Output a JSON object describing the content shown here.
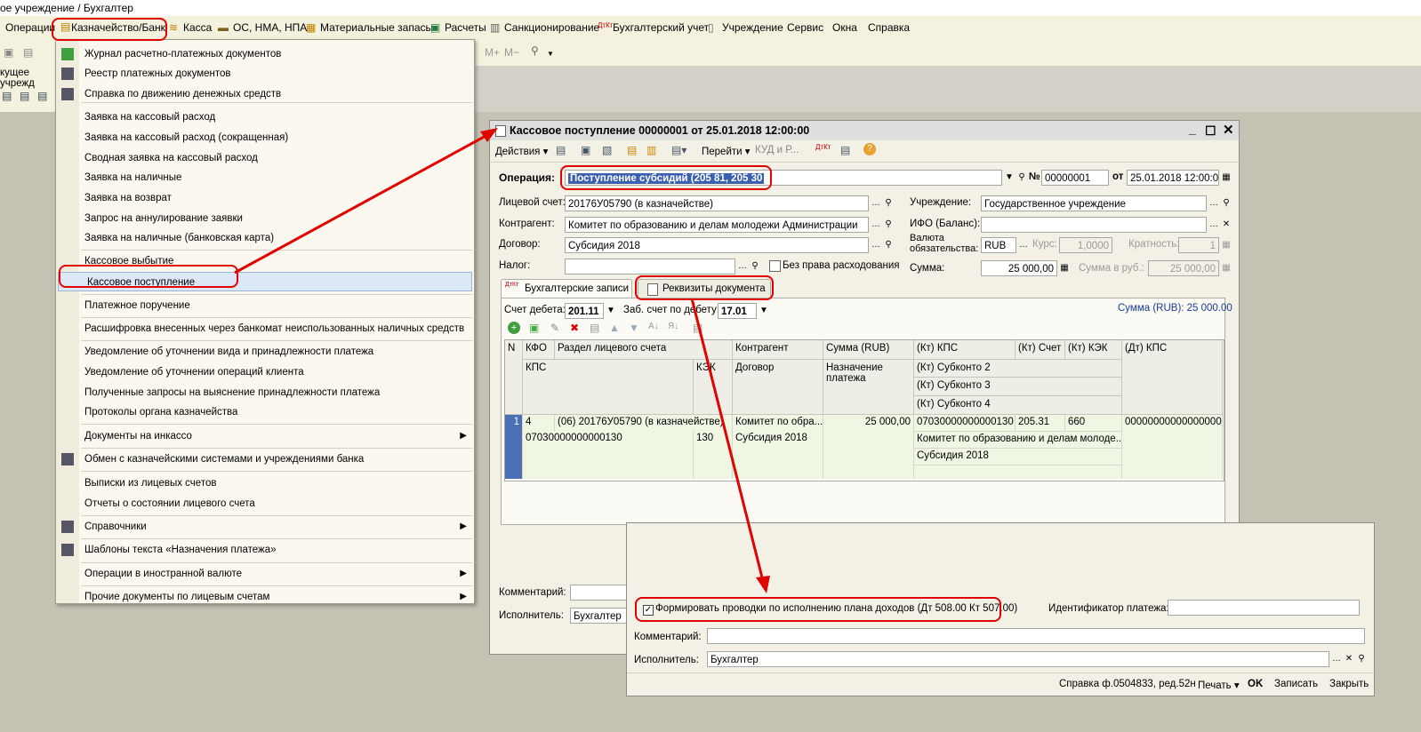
{
  "app_title": "ое учреждение / Бухгалтер",
  "menubar": {
    "items": [
      "Операции",
      "Казначейство/Банк",
      "Касса",
      "ОС, НМА, НПА",
      "Материальные запасы",
      "Расчеты",
      "Санкционирование",
      "Бухгалтерский учет",
      "Учреждение",
      "Сервис",
      "Окна",
      "Справка"
    ]
  },
  "sidebar_label": "кущее учрежд",
  "toolbar_right": {
    "mplus": "М+",
    "mminus": "М−"
  },
  "menu": {
    "items": [
      {
        "label": "Журнал  расчетно-платежных документов",
        "arrow": false
      },
      {
        "label": "Реестр платежных документов",
        "arrow": false
      },
      {
        "label": "Справка по движению денежных средств",
        "arrow": false
      },
      {
        "label": "Заявка на кассовый расход",
        "arrow": false
      },
      {
        "label": "Заявка на кассовый расход (сокращенная)",
        "arrow": false
      },
      {
        "label": "Сводная заявка на кассовый расход",
        "arrow": false
      },
      {
        "label": "Заявка на наличные",
        "arrow": false
      },
      {
        "label": "Заявка на возврат",
        "arrow": false
      },
      {
        "label": "Запрос на аннулирование заявки",
        "arrow": false
      },
      {
        "label": "Заявка на наличные (банковская карта)",
        "arrow": false
      },
      {
        "label": "Кассовое выбытие",
        "arrow": false
      },
      {
        "label": "Кассовое поступление",
        "arrow": false
      },
      {
        "label": "Платежное поручение",
        "arrow": false
      },
      {
        "label": "Расшифровка внесенных через банкомат неиспользованных наличных средств",
        "arrow": false
      },
      {
        "label": "Уведомление об уточнении вида и принадлежности платежа",
        "arrow": false
      },
      {
        "label": "Уведомление об уточнении операций клиента",
        "arrow": false
      },
      {
        "label": "Полученные запросы на выяснение принадлежности платежа",
        "arrow": false
      },
      {
        "label": "Протоколы органа казначейства",
        "arrow": false
      },
      {
        "label": "Документы на инкассо",
        "arrow": true
      },
      {
        "label": "Обмен с казначейскими системами и учреждениями банка",
        "arrow": false
      },
      {
        "label": "Выписки из лицевых счетов",
        "arrow": false
      },
      {
        "label": "Отчеты о состоянии лицевого счета",
        "arrow": false
      },
      {
        "label": "Справочники",
        "arrow": true
      },
      {
        "label": "Шаблоны текста «Назначения платежа»",
        "arrow": false
      },
      {
        "label": "Операции в иностранной валюте",
        "arrow": true
      },
      {
        "label": "Прочие документы по лицевым счетам",
        "arrow": true
      }
    ]
  },
  "doc": {
    "title": "Кассовое поступление 00000001 от 25.01.2018 12:00:00",
    "toolbar": {
      "actions": "Действия",
      "goto": "Перейти",
      "kud": "КУД и Р..."
    },
    "operation_label": "Операция:",
    "operation_value": "Поступление субсидий (205 81, 205 30",
    "number_label": "№",
    "number_value": "00000001",
    "date_label": "от",
    "date_value": "25.01.2018 12:00:00",
    "account_label": "Лицевой счет:",
    "account_value": "20176У05790 (в казначействе)",
    "contractor_label": "Контрагент:",
    "contractor_value": "Комитет по образованию и делам молодежи Администрации",
    "contract_label": "Договор:",
    "contract_value": "Субсидия 2018",
    "tax_label": "Налог:",
    "tax_value": "",
    "no_rights_label": "Без права расходования",
    "institution_label": "Учреждение:",
    "institution_value": "Государственное учреждение",
    "ifo_label": "ИФО (Баланс):",
    "ifo_value": "",
    "currency_label": "Валюта обязательства:",
    "currency_value": "RUB",
    "rate_label": "Курс:",
    "rate_value": "1,0000",
    "mult_label": "Кратность:",
    "mult_value": "1",
    "sum_label": "Сумма:",
    "sum_value": "25 000,00",
    "sum_rub_label": "Сумма в руб.:",
    "sum_rub_value": "25 000,00",
    "tabs": [
      "Бухгалтерские записи",
      "Реквизиты документа"
    ],
    "debit_label": "Счет дебета:",
    "debit_value": "201.11",
    "offbal_label": "Заб. счет по дебету:",
    "offbal_value": "17.01",
    "total_text": "Сумма (RUB): 25 000.00",
    "grid_headers": {
      "n": "N",
      "kfo": "КФО",
      "section": "Раздел лицевого счета",
      "contractor": "Контрагент",
      "sum": "Сумма (RUB)",
      "kt_kps": "(Кт) КПС",
      "kt_acc": "(Кт) Счет",
      "kt_kek": "(Кт) КЭК",
      "dt_kps": "(Дт) КПС",
      "kps": "КПС",
      "kek": "КЭК",
      "contract": "Договор",
      "purpose": "Назначение платежа",
      "sub2": "(Кт) Субконто 2",
      "sub3": "(Кт) Субконто 3",
      "sub4": "(Кт) Субконто 4"
    },
    "row": {
      "n": "1",
      "kfo": "4",
      "section": "(06) 20176У05790 (в казначействе)",
      "contractor": "Комитет по обра...",
      "sum": "25 000,00",
      "kt_kps": "07030000000000130",
      "kt_acc": "205.31",
      "kt_kek": "660",
      "dt_kps": "00000000000000000",
      "kps": "07030000000000130",
      "kek": "130",
      "contract": "Субсидия 2018",
      "sub2": "Комитет по образованию и делам молоде...",
      "sub3": "Субсидия 2018"
    },
    "comment_label": "Комментарий:",
    "executor_label": "Исполнитель:",
    "executor_value": "Бухгалтер"
  },
  "doc2": {
    "checkbox_label": "Формировать проводки по исполнению плана доходов (Дт 508.00 Кт 507.00)",
    "checkbox_checked": true,
    "payment_id_label": "Идентификатор платежа:",
    "payment_id_value": "",
    "comment_label": "Комментарий:",
    "comment_value": "",
    "executor_label": "Исполнитель:",
    "executor_value": "Бухгалтер",
    "footer": {
      "report": "Справка ф.0504833, ред.52н",
      "print": "Печать",
      "ok": "OK",
      "save": "Записать",
      "close": "Закрыть"
    }
  },
  "colors": {
    "highlight_red": "#e00000",
    "selected_row": "#d6e4f7",
    "selected_marker": "#4a6fb5"
  }
}
